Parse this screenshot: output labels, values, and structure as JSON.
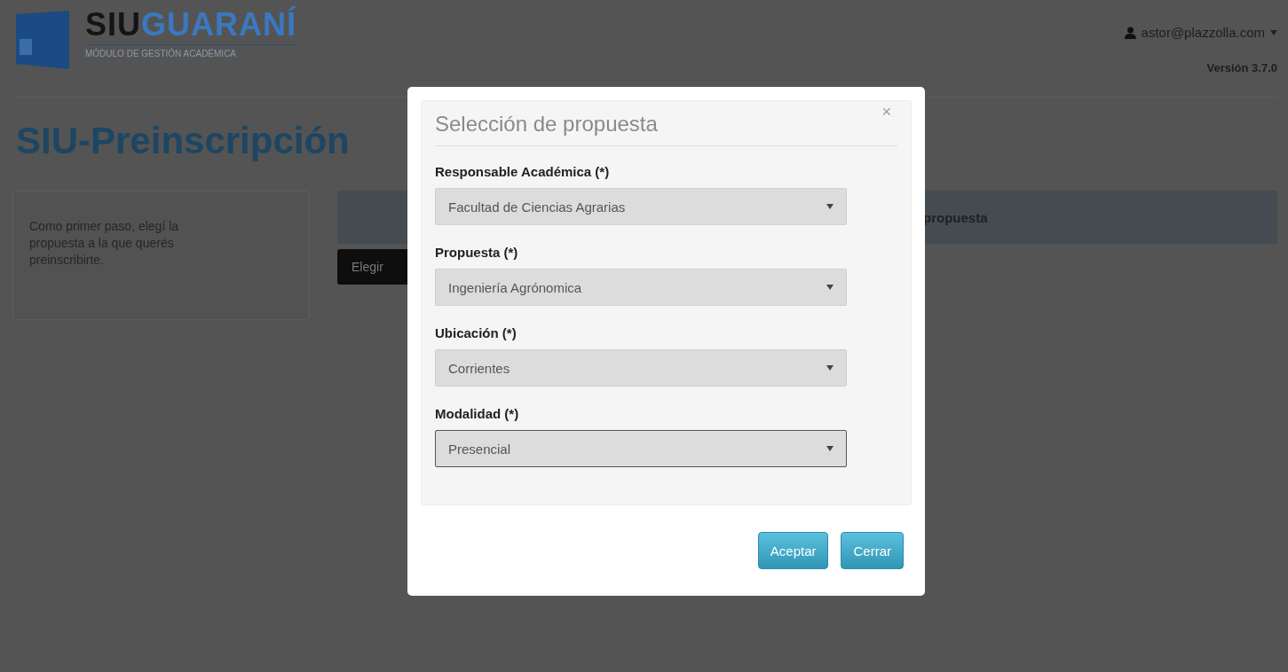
{
  "header": {
    "logo": {
      "brand_dark": "SIU",
      "brand_light": "GUARANÍ",
      "subtitle": "MÓDULO DE GESTIÓN ACADÉMICA"
    },
    "user": "astor@plazzolla.com",
    "version": "Versión 3.7.0"
  },
  "page_title": "SIU-Preinscripción",
  "intro_card": {
    "text": "Como primer paso, elegí la propuesta a la que querés preinscribirte."
  },
  "panel": {
    "heading": "propuesta",
    "button": "Elegir"
  },
  "modal": {
    "title": "Selección de propuesta",
    "close": "×",
    "fields": [
      {
        "label": "Responsable Académica (*)",
        "value": "Facultad de Ciencias Agrarias",
        "focused": false
      },
      {
        "label": "Propuesta (*)",
        "value": "Ingeniería Agrónomica",
        "focused": false
      },
      {
        "label": "Ubicación (*)",
        "value": "Corrientes",
        "focused": false
      },
      {
        "label": "Modalidad (*)",
        "value": "Presencial",
        "focused": true
      }
    ],
    "buttons": [
      "Aceptar",
      "Cerrar"
    ]
  }
}
